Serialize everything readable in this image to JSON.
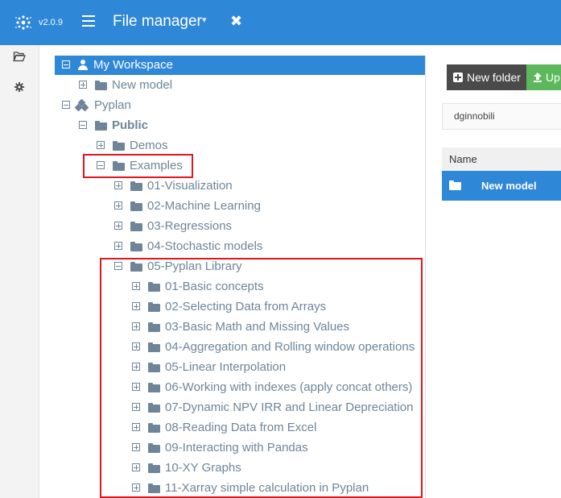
{
  "topbar": {
    "version": "v2.0.9",
    "title": "File manager",
    "caret": "▾",
    "close": "✖"
  },
  "sidebar": {
    "items": [
      {
        "icon": "folder-open-icon",
        "glyph": "🗁"
      },
      {
        "icon": "gear-icon",
        "glyph": "⚙"
      }
    ]
  },
  "tree": {
    "workspace": "My Workspace",
    "new_model": "New model",
    "pyplan": "Pyplan",
    "public": "Public",
    "demos": "Demos",
    "examples": "Examples",
    "examples_children": [
      "01-Visualization",
      "02-Machine Learning",
      "03-Regressions",
      "04-Stochastic models",
      "05-Pyplan Library"
    ],
    "library_children": [
      "01-Basic concepts",
      "02-Selecting Data from Arrays",
      "03-Basic Math and Missing Values",
      "04-Aggregation and Rolling window operations",
      "05-Linear Interpolation",
      "06-Working with indexes (apply concat others)",
      "07-Dynamic NPV IRR and Linear Depreciation",
      "08-Reading Data from Excel",
      "09-Interacting with Pandas",
      "10-XY Graphs",
      "11-Xarray simple calculation in Pyplan"
    ]
  },
  "panel": {
    "new_folder_label": "New folder",
    "upload_label": "Up",
    "path": "dginnobili",
    "table_header": "Name",
    "rows": [
      "New model"
    ]
  },
  "colors": {
    "accent": "#2f87d8",
    "tree_text": "#6e8599",
    "highlight_border": "#e0161d",
    "upload_green": "#5cb85c"
  }
}
